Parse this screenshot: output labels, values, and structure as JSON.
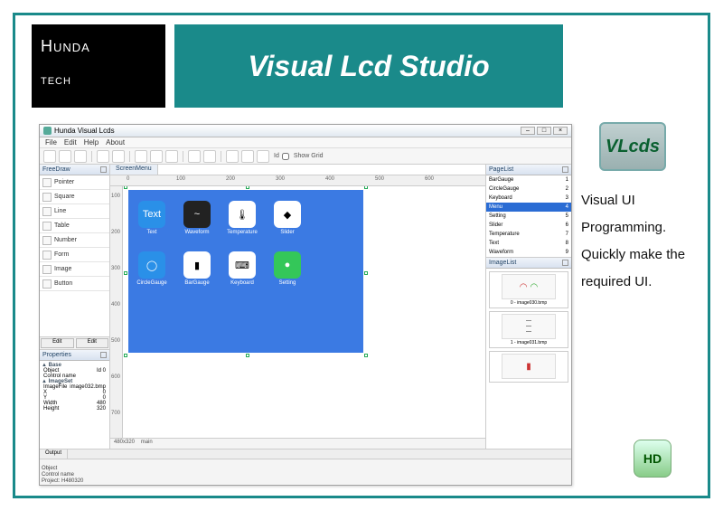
{
  "brand": {
    "line1": "Hunda",
    "line2": "tech"
  },
  "title": "Visual Lcd Studio",
  "promo_logo": "VLcds",
  "promo_text": "Visual UI Programming. Quickly make the required UI.",
  "hd_badge": "HD",
  "app": {
    "title": "Hunda Visual Lcds",
    "menu": [
      "File",
      "Edit",
      "Help",
      "About"
    ],
    "show_grid_label": "Show Grid",
    "id_label": "Id",
    "left_panel": {
      "header": "FreeDraw",
      "tools": [
        "Pointer",
        "Square",
        "Line",
        "Table",
        "Number",
        "Form",
        "Image",
        "Button"
      ],
      "edit_btns": [
        "Edit",
        "Edit"
      ]
    },
    "properties": {
      "header": "Properties",
      "group1": "Base",
      "rows1": [
        [
          "Object",
          "Id 0"
        ],
        [
          "Control name",
          ""
        ]
      ],
      "group2": "ImageSet",
      "rows2": [
        [
          "ImageFile",
          "image032.bmp"
        ],
        [
          "X",
          "0"
        ],
        [
          "Y",
          "0"
        ],
        [
          "Width",
          "480"
        ],
        [
          "Height",
          "320"
        ]
      ]
    },
    "canvas": {
      "tab": "ScreenMenu",
      "ruler_h": [
        "0",
        "100",
        "200",
        "300",
        "400",
        "500",
        "600"
      ],
      "ruler_v": [
        "100",
        "200",
        "300",
        "400",
        "500",
        "600",
        "700"
      ],
      "size_label": "480x320",
      "main_label": "main",
      "widgets": [
        {
          "icon": "Text",
          "label": "Text",
          "cls": "blue"
        },
        {
          "icon": "~",
          "label": "Waveform",
          "cls": "dark"
        },
        {
          "icon": "🌡",
          "label": "Temperature",
          "cls": ""
        },
        {
          "icon": "◆",
          "label": "Slider",
          "cls": ""
        },
        {
          "icon": "◯",
          "label": "CircleGauge",
          "cls": "blue"
        },
        {
          "icon": "▮",
          "label": "BarGauge",
          "cls": ""
        },
        {
          "icon": "⌨",
          "label": "Keyboard",
          "cls": ""
        },
        {
          "icon": "●",
          "label": "Setting",
          "cls": "green"
        }
      ]
    },
    "pagelist": {
      "header": "PageList",
      "rows": [
        [
          "BarGauge",
          "1"
        ],
        [
          "CircleGauge",
          "2"
        ],
        [
          "Keyboard",
          "3"
        ],
        [
          "Menu",
          "4"
        ],
        [
          "Setting",
          "5"
        ],
        [
          "Slider",
          "6"
        ],
        [
          "Temperature",
          "7"
        ],
        [
          "Text",
          "8"
        ],
        [
          "Waveform",
          "9"
        ]
      ],
      "selected": 3
    },
    "imagelist": {
      "header": "ImageList",
      "items": [
        {
          "caption": "0 - image030.bmp"
        },
        {
          "caption": "1 - image031.bmp"
        },
        {
          "caption": ""
        }
      ]
    },
    "output_tab": "Output",
    "status": {
      "object": "Object",
      "control": "Control name",
      "project": "Project: H480320"
    }
  }
}
